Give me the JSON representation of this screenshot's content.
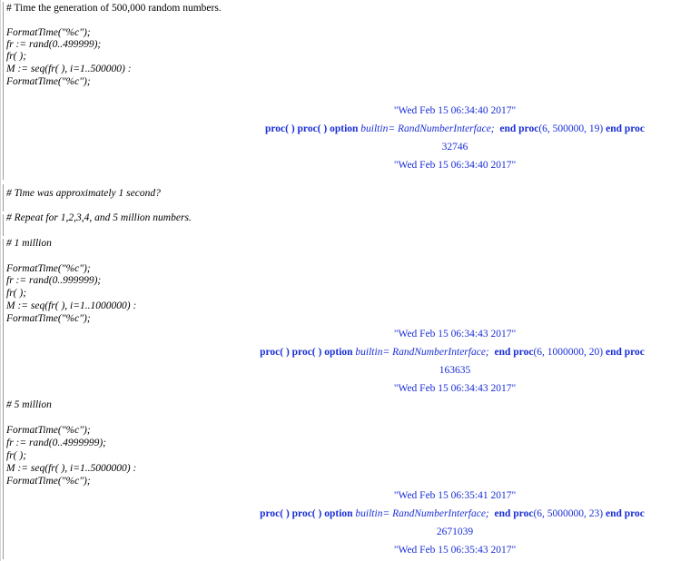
{
  "block1": {
    "comment": "# Time the generation of 500,000 random numbers.",
    "code": [
      "FormatTime(\"%c\");",
      "fr := rand(0..499999);",
      "fr( );",
      "M := seq(fr( ), i=1..500000) :",
      "FormatTime(\"%c\");"
    ],
    "out_time1": "\"Wed Feb 15 06:34:40 2017\"",
    "out_proc": {
      "a": "proc( )",
      "b": "proc( )",
      "c": "option",
      "d": "builtin",
      "e": "= RandNumberInterface;",
      "f": "end proc",
      "g": "(6, 500000, 19)",
      "h": "end proc"
    },
    "out_value": "32746",
    "out_time2": "\"Wed Feb 15 06:34:40 2017\""
  },
  "comments": {
    "c1": "# Time was approximately 1 second?",
    "c2": "# Repeat for 1,2,3,4, and 5 million numbers.",
    "c3": "# 1 million"
  },
  "block2": {
    "code": [
      "FormatTime(\"%c\");",
      "fr := rand(0..999999);",
      "fr( );",
      "M := seq(fr( ), i=1..1000000) :",
      "FormatTime(\"%c\");"
    ],
    "out_time1": "\"Wed Feb 15 06:34:43 2017\"",
    "out_proc": {
      "a": "proc( )",
      "b": "proc( )",
      "c": "option",
      "d": "builtin",
      "e": "= RandNumberInterface;",
      "f": "end proc",
      "g": "(6, 1000000, 20)",
      "h": "end proc"
    },
    "out_value": "163635",
    "out_time2": "\"Wed Feb 15 06:34:43 2017\""
  },
  "comment5": "# 5  million",
  "block3": {
    "code": [
      "FormatTime(\"%c\");",
      "fr := rand(0..4999999);",
      "fr( );",
      "M := seq(fr( ), i=1..5000000) :",
      "FormatTime(\"%c\");"
    ],
    "out_time1": "\"Wed Feb 15 06:35:41 2017\"",
    "out_proc": {
      "a": "proc( )",
      "b": "proc( )",
      "c": "option",
      "d": "builtin",
      "e": "= RandNumberInterface;",
      "f": "end proc",
      "g": "(6, 5000000, 23)",
      "h": "end proc"
    },
    "out_value": "2671039",
    "out_time2": "\"Wed Feb 15 06:35:43 2017\""
  }
}
